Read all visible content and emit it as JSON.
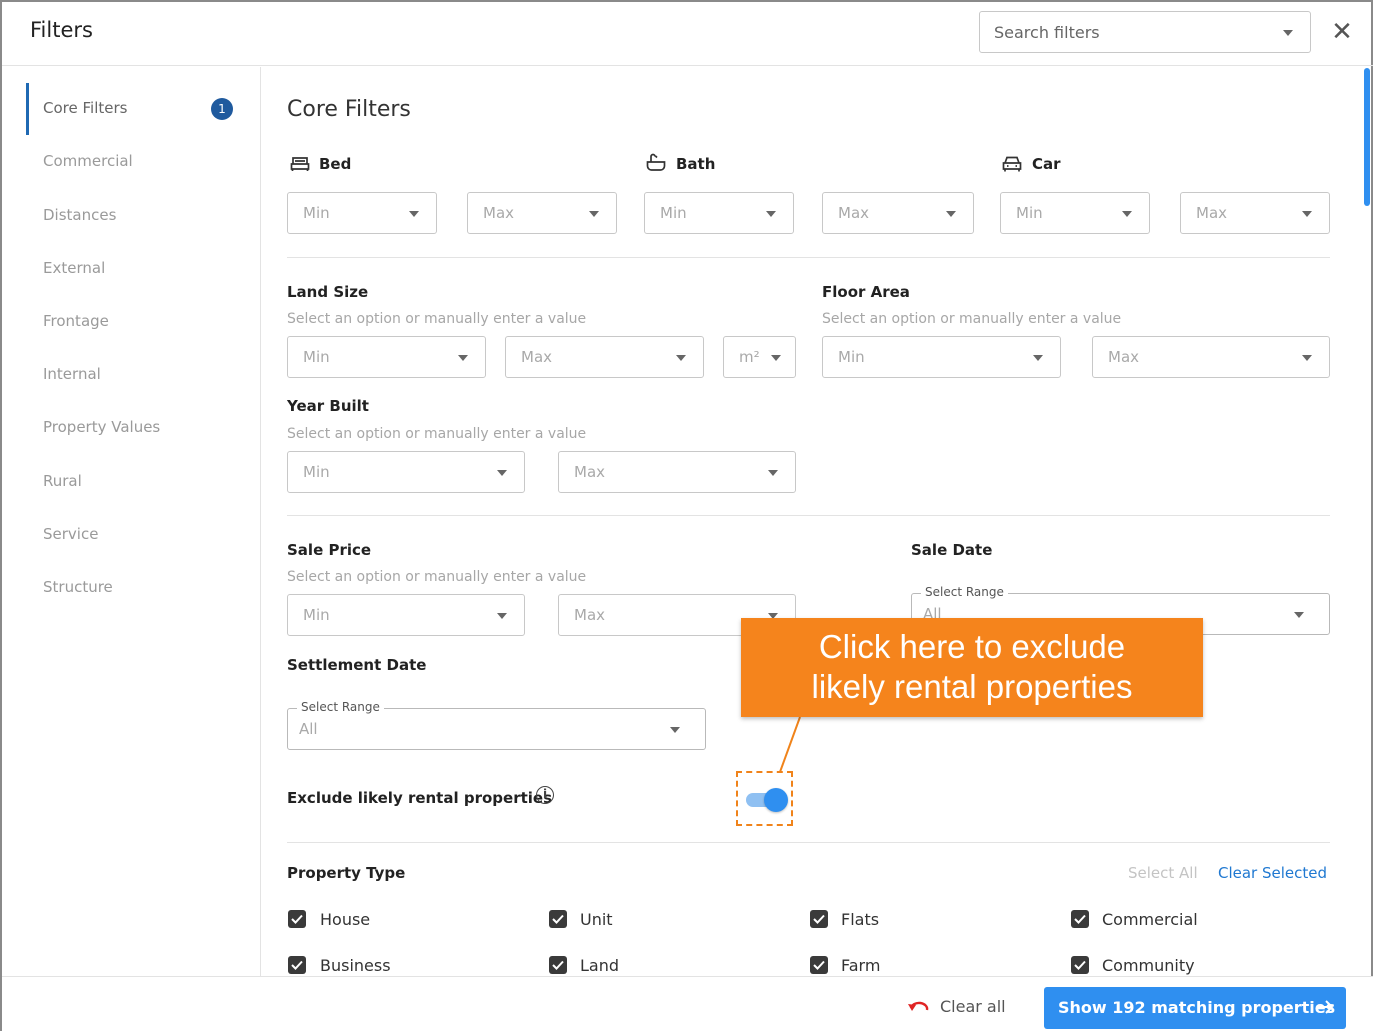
{
  "header": {
    "title": "Filters",
    "search_placeholder": "Search filters",
    "close_glyph": "✕"
  },
  "sidebar": {
    "items": [
      {
        "label": "Core Filters",
        "badge": "1"
      },
      {
        "label": "Commercial"
      },
      {
        "label": "Distances"
      },
      {
        "label": "External"
      },
      {
        "label": "Frontage"
      },
      {
        "label": "Internal"
      },
      {
        "label": "Property Values"
      },
      {
        "label": "Rural"
      },
      {
        "label": "Service"
      },
      {
        "label": "Structure"
      }
    ]
  },
  "main": {
    "title": "Core Filters",
    "bed": {
      "label": "Bed",
      "min": "Min",
      "max": "Max"
    },
    "bath": {
      "label": "Bath",
      "min": "Min",
      "max": "Max"
    },
    "car": {
      "label": "Car",
      "min": "Min",
      "max": "Max"
    },
    "land_size": {
      "label": "Land Size",
      "hint": "Select an option or manually enter a value",
      "min": "Min",
      "max": "Max",
      "unit": "m²"
    },
    "floor_area": {
      "label": "Floor Area",
      "hint": "Select an option or manually enter a value",
      "min": "Min",
      "max": "Max"
    },
    "year_built": {
      "label": "Year Built",
      "hint": "Select an option or manually enter a value",
      "min": "Min",
      "max": "Max"
    },
    "sale_price": {
      "label": "Sale Price",
      "hint": "Select an option or manually enter a value",
      "min": "Min",
      "max": "Max"
    },
    "sale_date": {
      "label": "Sale Date",
      "legend": "Select Range",
      "value": "All"
    },
    "settlement_date": {
      "label": "Settlement Date",
      "legend": "Select Range",
      "value": "All"
    },
    "exclude_rental": {
      "label": "Exclude likely rental properties",
      "info_glyph": "i",
      "enabled": true
    },
    "property_type": {
      "label": "Property Type",
      "select_all": "Select All",
      "clear_selected": "Clear Selected",
      "options": [
        "House",
        "Unit",
        "Flats",
        "Commercial",
        "Business",
        "Land",
        "Farm",
        "Community"
      ]
    }
  },
  "callout": {
    "line1": "Click here to exclude",
    "line2": "likely rental properties"
  },
  "footer": {
    "clear_all": "Clear all",
    "show_button": "Show 192 matching properties"
  },
  "colors": {
    "accent": "#2f8ff0",
    "badge": "#1f5a9e",
    "callout": "#f5841c",
    "link": "#1f78d1"
  }
}
